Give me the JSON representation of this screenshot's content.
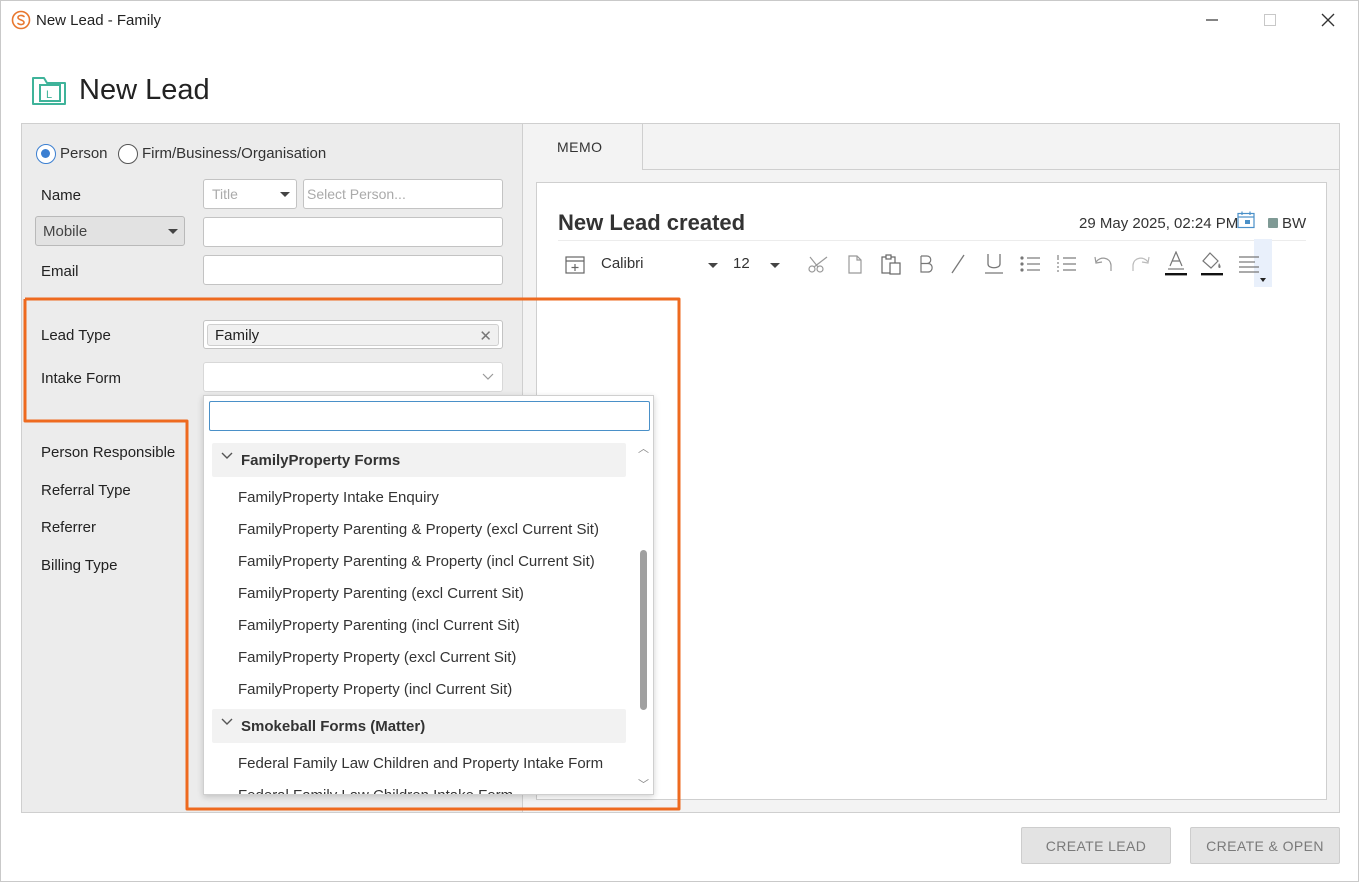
{
  "window": {
    "title": "New Lead - Family",
    "min_glyph": "—",
    "max_glyph": "☐",
    "close_glyph": "✕"
  },
  "header": {
    "title": "New Lead",
    "icon": "lead-folder-icon",
    "icon_letter": "L"
  },
  "contact_type": {
    "options": [
      {
        "label": "Person",
        "checked": true
      },
      {
        "label": "Firm/Business/Organisation",
        "checked": false
      }
    ]
  },
  "form": {
    "name_label": "Name",
    "title_placeholder": "Title",
    "person_placeholder": "Select Person...",
    "phone_type_value": "Mobile",
    "phone_value": "",
    "email_label": "Email",
    "email_value": "",
    "lead_type_label": "Lead Type",
    "lead_type_value": "Family",
    "lead_type_clear": "✕",
    "intake_form_label": "Intake Form",
    "intake_form_value": "",
    "person_responsible_label": "Person Responsible",
    "referral_type_label": "Referral Type",
    "referrer_label": "Referrer",
    "billing_type_label": "Billing Type"
  },
  "intake_dropdown": {
    "search_value": "",
    "groups": [
      {
        "label": "FamilyProperty Forms",
        "expanded": true,
        "items": [
          "FamilyProperty Intake Enquiry",
          "FamilyProperty Parenting & Property (excl Current Sit)",
          "FamilyProperty Parenting & Property (incl Current Sit)",
          "FamilyProperty Parenting (excl Current Sit)",
          "FamilyProperty Parenting (incl Current Sit)",
          "FamilyProperty Property (excl Current Sit)",
          "FamilyProperty Property (incl Current Sit)"
        ]
      },
      {
        "label": "Smokeball Forms (Matter)",
        "expanded": true,
        "items": [
          "Federal Family Law Children and Property Intake Form",
          "Federal Family Law Children Intake Form"
        ]
      }
    ]
  },
  "memo": {
    "tab_label": "MEMO",
    "title": "New Lead created",
    "date": "29 May 2025, 02:24 PM",
    "initials": "BW",
    "author_color": "#7f9a95",
    "font_name": "Calibri",
    "font_size": "12",
    "toolbar_icons": [
      "insert-date-icon",
      "cut-icon",
      "copy-icon",
      "paste-icon",
      "bold-icon",
      "italic-icon",
      "underline-icon",
      "bullet-list-icon",
      "numbered-list-icon",
      "undo-icon",
      "redo-icon",
      "font-color-icon",
      "highlight-color-icon",
      "align-icon"
    ]
  },
  "buttons": {
    "create_lead": "CREATE LEAD",
    "create_open": "CREATE & OPEN"
  },
  "colors": {
    "highlight": "#ee6a1f",
    "accent_blue": "#3b7fd1",
    "brand_orange": "#e8772e",
    "lead_icon_green": "#3fb39a"
  }
}
